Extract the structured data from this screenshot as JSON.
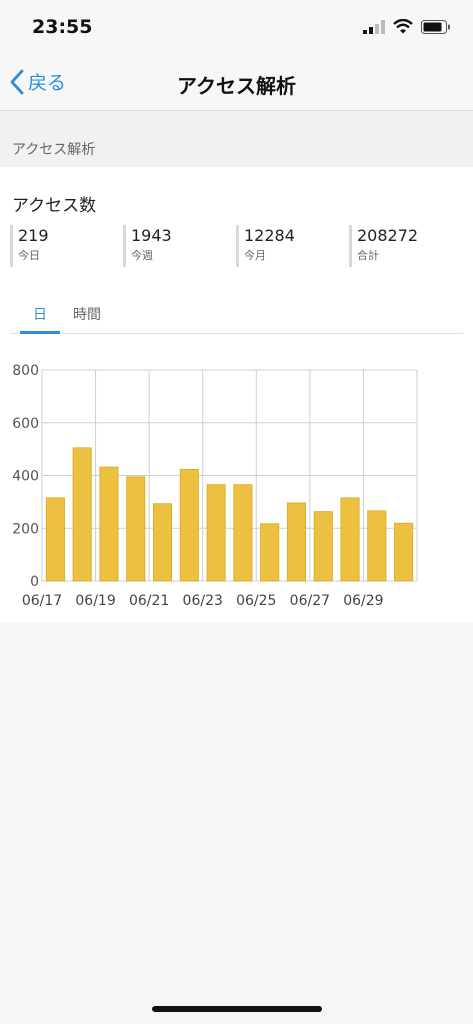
{
  "status_bar": {
    "time": "23:55"
  },
  "nav": {
    "back_label": "戻る",
    "title": "アクセス解析"
  },
  "section": {
    "header": "アクセス解析"
  },
  "card": {
    "title": "アクセス数",
    "stats": [
      {
        "value": "219",
        "label": "今日"
      },
      {
        "value": "1943",
        "label": "今週"
      },
      {
        "value": "12284",
        "label": "今月"
      },
      {
        "value": "208272",
        "label": "合計"
      }
    ]
  },
  "tabs": {
    "day": "日",
    "hour": "時間",
    "active": "day"
  },
  "colors": {
    "accent": "#2e8fd8",
    "bar": "#edc042",
    "bar_border": "#d9a818"
  },
  "chart_data": {
    "type": "bar",
    "categories": [
      "06/17",
      "06/18",
      "06/19",
      "06/20",
      "06/21",
      "06/22",
      "06/23",
      "06/24",
      "06/25",
      "06/26",
      "06/27",
      "06/28",
      "06/29",
      "06/30"
    ],
    "tick_labels": [
      "06/17",
      "06/19",
      "06/21",
      "06/23",
      "06/25",
      "06/27",
      "06/29"
    ],
    "values": [
      315,
      505,
      432,
      395,
      293,
      423,
      365,
      365,
      217,
      296,
      263,
      315,
      266,
      219
    ],
    "ylim": [
      0,
      800
    ],
    "yticks": [
      0,
      200,
      400,
      600,
      800
    ],
    "grid": true
  }
}
